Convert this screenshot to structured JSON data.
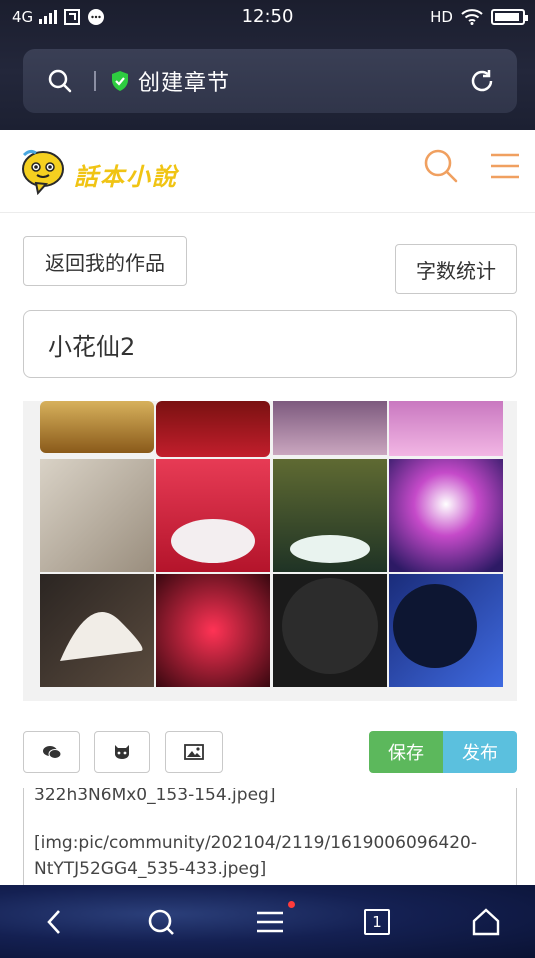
{
  "status_bar": {
    "network": "4G",
    "time": "12:50",
    "hd": "HD"
  },
  "url_bar": {
    "page_title": "创建章节",
    "icons": [
      "search-icon",
      "shield-check-icon",
      "reload-icon"
    ]
  },
  "site": {
    "logo_text": "話本小說",
    "icons": [
      "search-icon",
      "menu-icon"
    ],
    "accent_color": "#f0a060"
  },
  "actions": {
    "back_label": "返回我的作品",
    "word_count_label": "字数统计"
  },
  "chapter": {
    "title_value": "小花仙2"
  },
  "toolbar": {
    "icons": [
      "comment-icon",
      "github-icon",
      "image-icon"
    ],
    "save_label": "保存",
    "publish_label": "发布",
    "save_color": "#5cb85c",
    "publish_color": "#5bc0de"
  },
  "editor": {
    "line1": "322h3N6Mx0_153-154.jpeg]",
    "line2": "[img:pic/community/202104/2119/1619006096420-",
    "line3": "NtYTJ52GG4_535-433.jpeg]"
  },
  "bottom_nav": {
    "tab_count": "1",
    "icons": [
      "back-arrow-icon",
      "search-icon",
      "menu-icon",
      "tabs-icon",
      "home-icon"
    ]
  }
}
